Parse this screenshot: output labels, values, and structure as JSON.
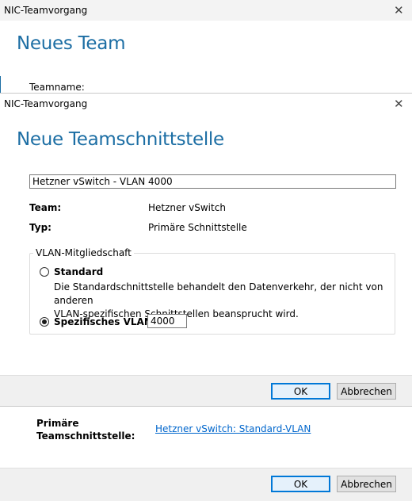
{
  "back_window": {
    "title": "NIC-Teamvorgang",
    "heading": "Neues Team",
    "teamname_label": "Teamname:",
    "primary_interface_label_line1": "Primäre",
    "primary_interface_label_line2": "Teamschnittstelle:",
    "primary_interface_link": "Hetzner vSwitch: Standard-VLAN",
    "ok_label": "OK",
    "cancel_label": "Abbrechen"
  },
  "dialog": {
    "title": "NIC-Teamvorgang",
    "heading": "Neue Teamschnittstelle",
    "name_value": "Hetzner vSwitch - VLAN 4000",
    "team_label": "Team:",
    "team_value": "Hetzner vSwitch",
    "type_label": "Typ:",
    "type_value": "Primäre Schnittstelle",
    "vlan_group_label": "VLAN-Mitgliedschaft",
    "standard_label": "Standard",
    "standard_desc_line1": "Die Standardschnittstelle behandelt den Datenverkehr, der nicht von anderen",
    "standard_desc_line2": "VLAN-spezifischen Schnittstellen beansprucht wird.",
    "specific_vlan_label": "Spezifisches VLAN:",
    "specific_vlan_value": "4000",
    "selected_option": "specific",
    "ok_label": "OK",
    "cancel_label": "Abbrechen"
  },
  "icons": {
    "close": "close-icon",
    "radio": "radio-icon"
  },
  "colors": {
    "heading_blue": "#1c6ea4",
    "link_blue": "#0066cc",
    "footer_gray": "#f0f0f0",
    "default_button_border": "#0078d7"
  }
}
